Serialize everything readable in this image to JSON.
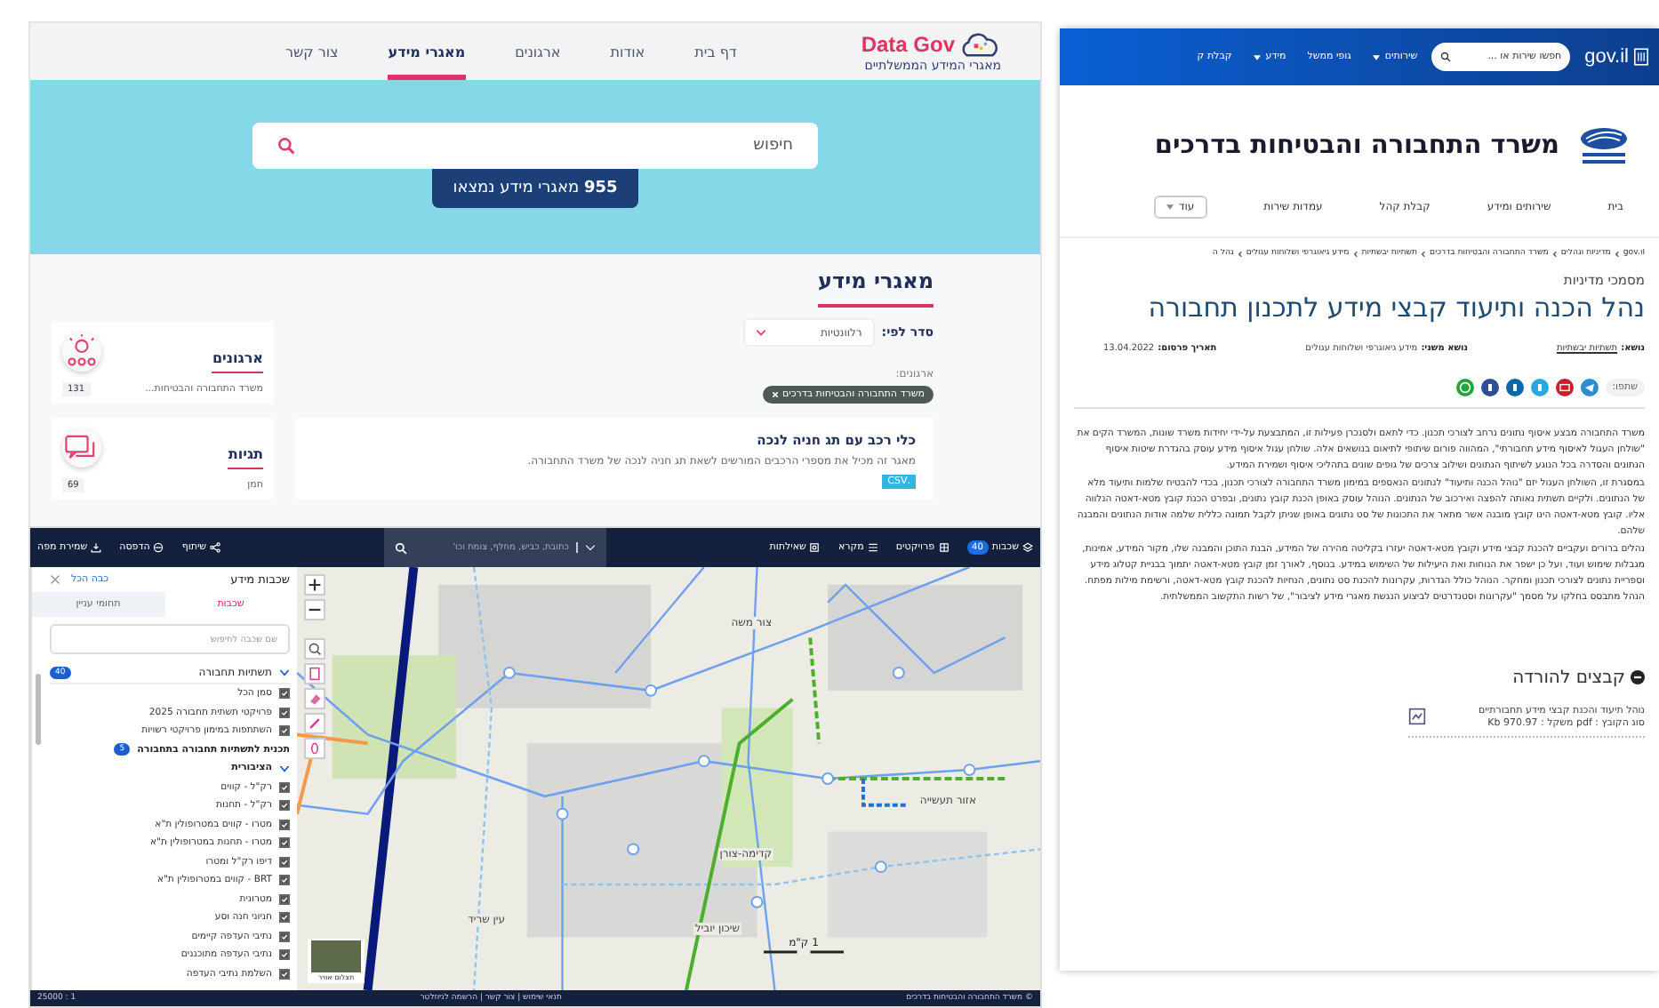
{
  "datagov": {
    "logo_title": "Data Gov",
    "logo_subtitle": "מאגרי המידע הממשלתיים",
    "nav": [
      {
        "label": "דף בית",
        "selected": false
      },
      {
        "label": "אודות",
        "selected": false
      },
      {
        "label": "ארגונים",
        "selected": false
      },
      {
        "label": "מאגרי מידע",
        "selected": true
      },
      {
        "label": "צור קשר",
        "selected": false
      }
    ],
    "search": {
      "placeholder": "חיפוש"
    },
    "results_button": "**955** מאגרי מידע נמצאו",
    "section_title": "מאגרי מידע",
    "sort": {
      "label": "סדר לפי:",
      "value": "רלוונטיות"
    },
    "filter": {
      "label": "ארגונים:",
      "chip": "משרד התחבורה והבטיחות בדרכים"
    },
    "result": {
      "title": "כלי רכב עם תג חניה לנכה",
      "description": "מאגר זה מכיל את מספרי הרכבים המורשים לשאת תג חניה לנכה של משרד התחבורה.",
      "format": ".CSV"
    },
    "side_cards": [
      {
        "kind": "organizations",
        "title": "ארגונים",
        "subtitle": "משרד התחבורה והבטיחות...",
        "count": "131"
      },
      {
        "kind": "tags",
        "title": "תגיות",
        "subtitle": "חמן",
        "count": "69"
      }
    ]
  },
  "map_app": {
    "toolbar": [
      {
        "kind": "layers",
        "label": "שכבות",
        "badge": "40"
      },
      {
        "kind": "projects",
        "label": "פרויקטים"
      },
      {
        "kind": "legend",
        "label": "מקרא"
      },
      {
        "kind": "queries",
        "label": "שאילתות"
      }
    ],
    "search": {
      "placeholder": "כתובת, כביש, מחלף, צומת וכו'"
    },
    "actions": [
      {
        "kind": "share",
        "label": "שיתוף"
      },
      {
        "kind": "print",
        "label": "הדפסה"
      },
      {
        "kind": "save",
        "label": "שמירת מפה"
      }
    ],
    "map_labels": [
      "צור משה",
      "קדימה-צורן",
      "עין שריד",
      "אזור תעשייה",
      "שיכון יוביל"
    ],
    "scale_bar": "1 ק\"מ",
    "aerial_toggle": "תצלום אוויר",
    "scale": "1 : 25000",
    "footer_links": "תנאי שימוש | צור קשר | הרשמה לניוזלטר",
    "copyright": "© משרד התחבורה והבטיחות בדרכים",
    "layers_panel": {
      "title": "שכבות מידע",
      "turn_off_all": "כבה הכל",
      "tabs": [
        {
          "label": "שכבות",
          "selected": true
        },
        {
          "label": "תחומי עניין",
          "selected": false
        }
      ],
      "search": {
        "placeholder": "שם שכבה לחיפוש"
      },
      "group": {
        "label": "תשתיות תחבורה",
        "badge": "40",
        "expanded": true
      },
      "items": [
        {
          "kind": "check",
          "label": "סמן הכל",
          "checked": true
        },
        {
          "kind": "check",
          "label": "פרויקטי תשתית תחבורה 2025",
          "checked": true
        },
        {
          "kind": "check",
          "label": "השתתפות במימון פרויקטי רשויות",
          "checked": true
        },
        {
          "kind": "heading",
          "label": "תכנית לתשתיות תחבורה בתחבורה",
          "badge": "5"
        },
        {
          "kind": "group",
          "label": "הציבורית",
          "expanded": true
        },
        {
          "kind": "check",
          "label": "רק\"ל - קווים",
          "checked": true
        },
        {
          "kind": "check",
          "label": "רק\"ל - תחנות",
          "checked": true
        },
        {
          "kind": "check",
          "label": "מטרו - קווים במטרופולין ת\"א",
          "checked": true
        },
        {
          "kind": "check",
          "label": "מטרו - תחנות במטרופולין ת\"א",
          "checked": true
        },
        {
          "kind": "check",
          "label": "דיפו רק\"ל ומטרו",
          "checked": true
        },
        {
          "kind": "check",
          "label": "BRT - קווים במטרופולין ת\"א",
          "checked": true
        },
        {
          "kind": "check",
          "label": "מטרונית",
          "checked": true
        },
        {
          "kind": "check",
          "label": "חניוני חנה וסע",
          "checked": true
        },
        {
          "kind": "check",
          "label": "נתיבי העדפה קיימים",
          "checked": true
        },
        {
          "kind": "check",
          "label": "נתיבי העדפה מתוכננים",
          "checked": true
        },
        {
          "kind": "check",
          "label": "השלמת נתיבי העדפה",
          "checked": true
        }
      ]
    }
  },
  "govil": {
    "logo": "gov.il",
    "search": {
      "placeholder": "חפשו שירות או ..."
    },
    "top_nav": [
      {
        "label": "שירותים",
        "dropdown": true
      },
      {
        "label": "גופי ממשל",
        "dropdown": false
      },
      {
        "label": "מידע",
        "dropdown": true
      },
      {
        "label": "קבלת ק",
        "dropdown": false
      }
    ],
    "ministry": "משרד התחבורה והבטיחות בדרכים",
    "nav": [
      {
        "label": "בית",
        "dropdown": false
      },
      {
        "label": "שירותים ומידע",
        "dropdown": false
      },
      {
        "label": "קבלת קהל",
        "dropdown": false
      },
      {
        "label": "עמדות שירות",
        "dropdown": false
      },
      {
        "label": "עוד",
        "dropdown": true
      }
    ],
    "breadcrumbs": [
      "gov.il",
      "מדיניות ונהלים",
      "משרד התחבורה והבטיחות בדרכים",
      "תשתיות יבשתיות",
      "מידע גיאוגרפי ושלוחות עגולים",
      "נהל ה"
    ],
    "category": "מסמכי מדיניות",
    "title": "נהל הכנה ותיעוד קבצי מידע לתכנון תחבורה",
    "meta": [
      {
        "label": "נושא:",
        "value": "תשתיות יבשתיות",
        "link": true
      },
      {
        "label": "נושא משני:",
        "value": "מידע גיאוגרפי ושלוחות עגולים",
        "link": false
      },
      {
        "label": "תאריך פרסום:",
        "value": "13.04.2022",
        "link": false
      }
    ],
    "share_label": "שתפו:",
    "share_icons": [
      {
        "kind": "telegram",
        "color": "#2a8fd0"
      },
      {
        "kind": "mail",
        "color": "#c8202a"
      },
      {
        "kind": "twitter",
        "color": "#29a9e0"
      },
      {
        "kind": "linkedin",
        "color": "#0a66a8"
      },
      {
        "kind": "facebook",
        "color": "#2d4f95"
      },
      {
        "kind": "whatsapp",
        "color": "#1fa83a"
      }
    ],
    "paragraphs": [
      "משרד התחבורה מבצע איסוף נתונים נרחב לצורכי תכנון. כדי לתאם ולסנכרן פעילות זו, המתבצעת על-ידי יחידות משרד שונות, המשרד הקים את \"שולחן העגול לאיסוף מידע תחבורתי\", המהווה פורום שיתופי לתיאום בנושאים אלה. שולחן עגול איסוף מידע עוסק בהגדרת שיטות איסוף הנתונים והסדרה בכל הנוגע לשיתוף הנתונים ושילוב צרכים של גופים שונים בתהליכי איסוף ושמירת המידע.",
      "במסגרת זו, השולחן העגול יזם \"נוהל הכנה ותיעוד\" לנתונים הנאספים במימון משרד התחבורה לצורכי תכנון, בכדי להבטיח שלמות ותיעוד מלא של הנתונים. ולקיים תשתית נאותה להפצה ואירכוב של הנתונים. הנוהל עוסק באופן הכנת קובץ נתונים, ובפרט הכנת קובץ מטא-דאטה הנלווה אליו. קובץ מטא-דאטה הינו קובץ מובנה אשר מתאר את התכונות של סט נתונים באופן שניתן לקבל תמונה כללית שלמה אודות הנתונים והמבנה שלהם.",
      "נהלים ברורים ועקביים להכנת קבצי מידע וקובץ מטא-דאטה יעזרו בקליטה מהירה של המידע, הבנת התוכן והמבנה שלו, מקור המידע, אמינות, מגבלות שימוש ועוד, ועל כן ישפר את הנוחות ואת היעילות של השימוש במידע. בנוסף, לאורך זמן קובץ מטא-דאטה יתמוך בבניית קטלוג מידע וספריית נתונים לצורכי תכנון ומחקר. הנוהל כולל הגדרות, עקרונות להכנת סט נתונים, הנחיות להכנת קובץ מטא-דאטה, ורשימת מילות מפתח. הנהל מתבסס בחלקו על מסמך \"עקרונות וסטנדרטים לביצוע הנגשת מאגרי מידע לציבור\", של רשות התקשוב הממשלתית."
    ],
    "downloads_title": "קבצים להורדה",
    "file": {
      "name": "נוהל תיעוד והכנת קבצי מידע תחבורתיים",
      "details": "סוג הקובץ : pdf  משקל : 970.97 Kb"
    }
  }
}
